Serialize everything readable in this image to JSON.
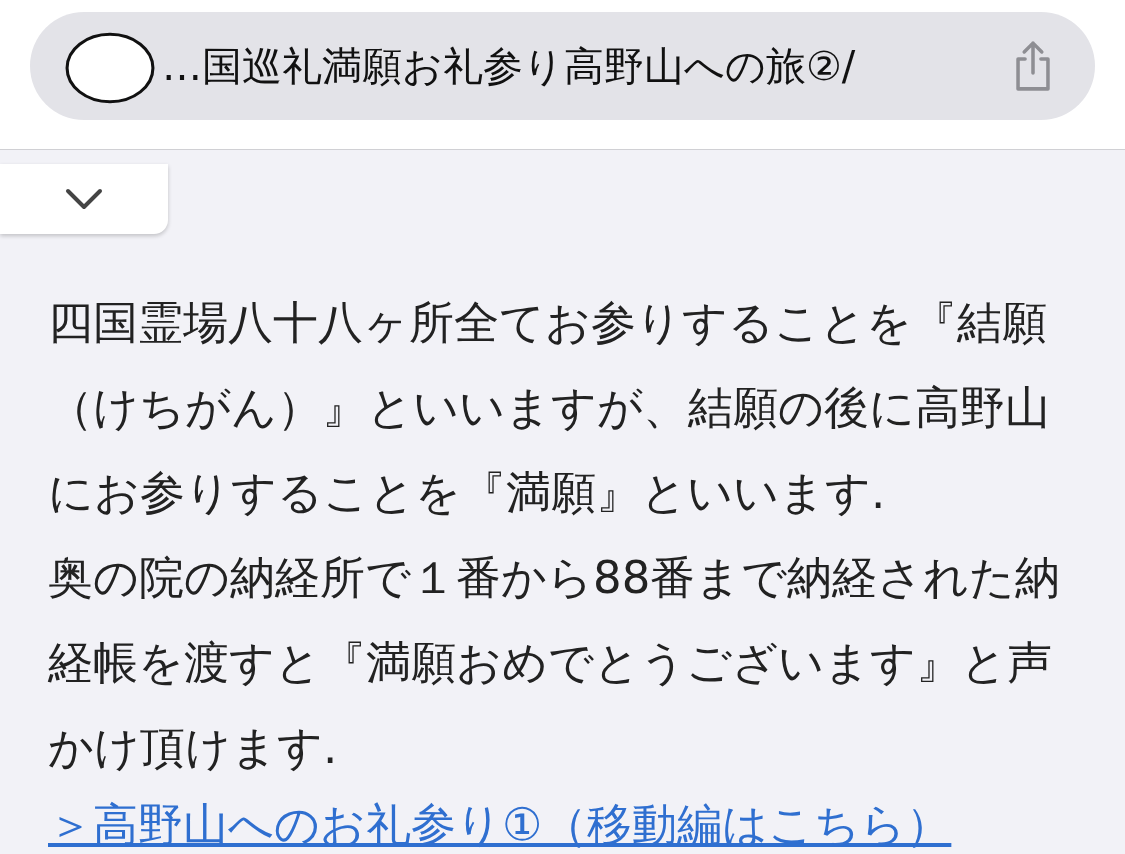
{
  "address_bar": {
    "title": "…国巡礼満願お礼参り高野山への旅②/"
  },
  "collapse_tab": {
    "expanded": false
  },
  "article": {
    "paragraphs": [
      "四国霊場八十八ヶ所全てお参りすることを『結願（けちがん）』といいますが、結願の後に高野山にお参りすることを『満願』といいます.",
      "奥の院の納経所で１番から88番まで納経された納経帳を渡すと『満願おめでとうございます』と声かけ頂けます."
    ],
    "link": "＞高野山へのお礼参り①（移動編はこちら）"
  }
}
